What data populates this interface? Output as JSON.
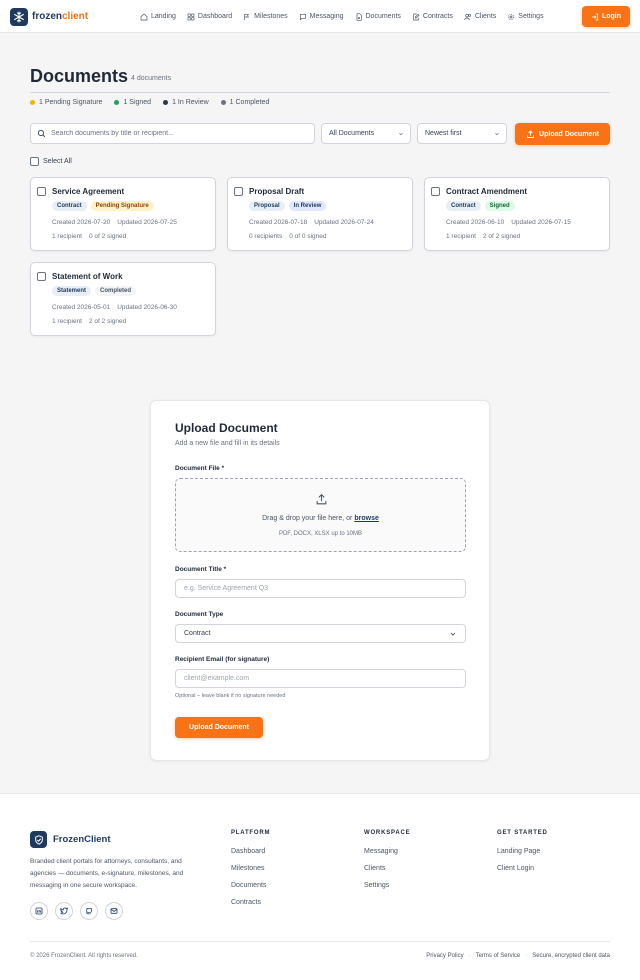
{
  "nav": {
    "logo_main": "frozen",
    "logo_accent": "client",
    "links": [
      "Landing",
      "Dashboard",
      "Milestones",
      "Messaging",
      "Documents",
      "Contracts",
      "Clients",
      "Settings"
    ],
    "login_label": "Login"
  },
  "header": {
    "title": "Documents",
    "count": "4 documents",
    "stats": [
      {
        "label": "1 Pending Signature",
        "color": "#f5b400"
      },
      {
        "label": "1 Signed",
        "color": "#22a05a"
      },
      {
        "label": "1 In Review",
        "color": "#1e3a5f"
      },
      {
        "label": "1 Completed",
        "color": "#6b7280"
      }
    ]
  },
  "toolbar": {
    "search_placeholder": "Search documents by title or recipient...",
    "filter_value": "All Documents",
    "sort_value": "Newest first",
    "upload_label": "Upload Document",
    "select_all_label": "Select All"
  },
  "documents": [
    {
      "title": "Service Agreement",
      "type": "Contract",
      "status": "Pending Signature",
      "created": "Created 2026-07-20",
      "updated": "Updated 2026-07-25",
      "recipients": "1 recipient",
      "signed": "0 of 2 signed"
    },
    {
      "title": "Proposal Draft",
      "type": "Proposal",
      "status": "In Review",
      "created": "Created 2026-07-18",
      "updated": "Updated 2026-07-24",
      "recipients": "0 recipients",
      "signed": "0 of 0 signed"
    },
    {
      "title": "Contract Amendment",
      "type": "Contract",
      "status": "Signed",
      "created": "Created 2026-06-10",
      "updated": "Updated 2026-07-15",
      "recipients": "1 recipient",
      "signed": "2 of 2 signed"
    },
    {
      "title": "Statement of Work",
      "type": "Statement",
      "status": "Completed",
      "created": "Created 2026-05-01",
      "updated": "Updated 2026-06-30",
      "recipients": "1 recipient",
      "signed": "2 of 2 signed"
    }
  ],
  "upload_form": {
    "title": "Upload Document",
    "subtitle": "Add a new file and fill in its details",
    "file_label": "Document File *",
    "dropzone_text": "Drag & drop your file here, or ",
    "dropzone_link": "browse",
    "dropzone_hint": "PDF, DOCX, XLSX up to 10MB",
    "title_label": "Document Title *",
    "title_placeholder": "e.g. Service Agreement Q3",
    "type_label": "Document Type",
    "type_value": "Contract",
    "email_label": "Recipient Email (for signature)",
    "email_placeholder": "client@example.com",
    "email_help": "Optional – leave blank if no signature needed",
    "submit_label": "Upload Document"
  },
  "footer": {
    "brand": "FrozenClient",
    "description": "Branded client portals for attorneys, consultants, and agencies — documents, e-signature, milestones, and messaging in one secure workspace.",
    "columns": [
      {
        "heading": "PLATFORM",
        "links": [
          "Dashboard",
          "Milestones",
          "Documents",
          "Contracts"
        ]
      },
      {
        "heading": "WORKSPACE",
        "links": [
          "Messaging",
          "Clients",
          "Settings"
        ]
      },
      {
        "heading": "GET STARTED",
        "links": [
          "Landing Page",
          "Client Login"
        ]
      }
    ],
    "copyright": "© 2026 FrozenClient. All rights reserved.",
    "privacy": "Privacy Policy",
    "terms": "Terms of Service",
    "secure": "Secure, encrypted client data"
  },
  "colors": {
    "accent": "#f97316",
    "brand": "#1e3a5f"
  }
}
